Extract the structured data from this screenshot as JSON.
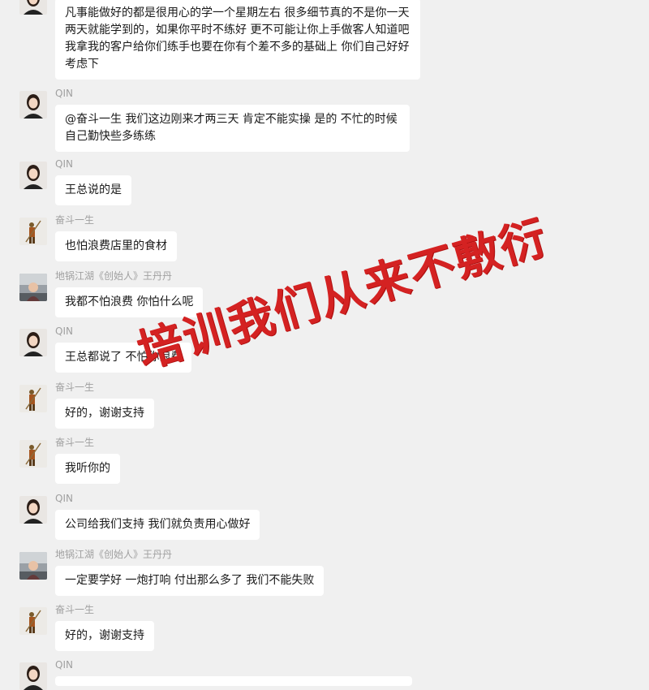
{
  "messages": [
    {
      "sender": "",
      "avatar": "avatar-qin-icon",
      "text": "凡事能做好的都是很用心的学一个星期左右 很多细节真的不是你一天两天就能学到的，如果你平时不练好 更不可能让你上手做客人知道吧  我拿我的客户给你们练手也要在你有个差不多的基础上 你们自己好好考虑下"
    },
    {
      "sender": "QIN",
      "avatar": "avatar-qin-icon",
      "text": "@奋斗一生 我们这边刚来才两三天  肯定不能实操 是的 不忙的时候自己勤快些多练练"
    },
    {
      "sender": "QIN",
      "avatar": "avatar-qin-icon",
      "text": "王总说的是"
    },
    {
      "sender": "奋斗一生",
      "avatar": "avatar-monkey-king-icon",
      "text": "也怕浪费店里的食材"
    },
    {
      "sender": "地锅江湖《创始人》王丹丹",
      "avatar": "avatar-car-icon",
      "text": "我都不怕浪费 你怕什么呢"
    },
    {
      "sender": "QIN",
      "avatar": "avatar-qin-icon",
      "text": "王总都说了 不怕你浪费"
    },
    {
      "sender": "奋斗一生",
      "avatar": "avatar-monkey-king-icon",
      "text": "好的，谢谢支持"
    },
    {
      "sender": "奋斗一生",
      "avatar": "avatar-monkey-king-icon",
      "text": "我听你的"
    },
    {
      "sender": "QIN",
      "avatar": "avatar-qin-icon",
      "text": "公司给我们支持 我们就负责用心做好"
    },
    {
      "sender": "地锅江湖《创始人》王丹丹",
      "avatar": "avatar-car-icon",
      "text": "一定要学好 一炮打响 付出那么多了 我们不能失败"
    },
    {
      "sender": "奋斗一生",
      "avatar": "avatar-monkey-king-icon",
      "text": "好的，谢谢支持"
    },
    {
      "sender": "QIN",
      "avatar": "avatar-qin-icon",
      "text": ""
    }
  ],
  "watermark": {
    "text": "培训我们从来不敷衍",
    "color": "#d42222"
  },
  "colors": {
    "background": "#f0f0f0",
    "bubble": "#ffffff",
    "sender": "#a0a0a0"
  }
}
